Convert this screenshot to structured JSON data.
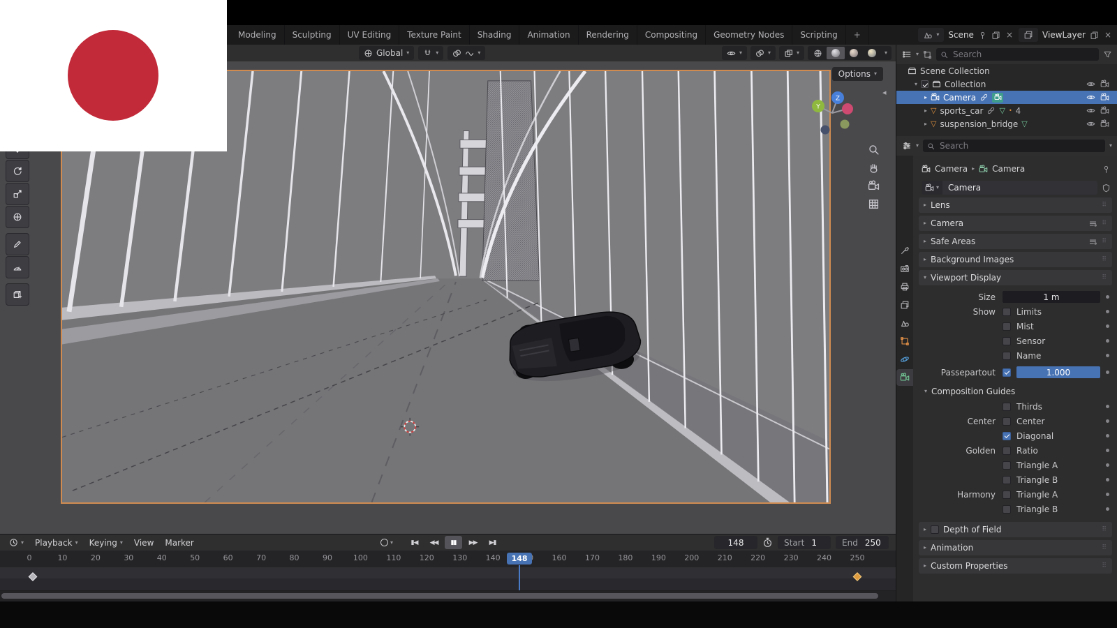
{
  "topbar": {
    "tabs": [
      "Modeling",
      "Sculpting",
      "UV Editing",
      "Texture Paint",
      "Shading",
      "Animation",
      "Rendering",
      "Compositing",
      "Geometry Nodes",
      "Scripting"
    ],
    "add_tab_label": "+",
    "scene_selector_label": "Scene",
    "view_layer_selector_label": "ViewLayer"
  },
  "viewport": {
    "header": {
      "orientation_label": "Global"
    },
    "options_label": "Options",
    "axis_labels": {
      "y": "Y",
      "z": "Z"
    }
  },
  "outliner": {
    "search_placeholder": "Search",
    "scene_collection_label": "Scene Collection",
    "collection_label": "Collection",
    "collection_checked": true,
    "camera_label": "Camera",
    "sports_car_label": "sports_car",
    "sports_car_count": "4",
    "suspension_bridge_label": "suspension_bridge"
  },
  "properties": {
    "search_placeholder": "Search",
    "breadcrumb_object": "Camera",
    "breadcrumb_data": "Camera",
    "name_value": "Camera",
    "panel_lens": "Lens",
    "panel_camera": "Camera",
    "panel_safe_areas": "Safe Areas",
    "panel_background_images": "Background Images",
    "panel_viewport_display": "Viewport Display",
    "panel_composition_guides": "Composition Guides",
    "panel_depth_of_field": "Depth of Field",
    "panel_animation": "Animation",
    "panel_custom_properties": "Custom Properties",
    "depth_of_field_checked": false,
    "viewport_display": {
      "size_label": "Size",
      "size_value": "1 m",
      "show_label": "Show",
      "limits_label": "Limits",
      "limits_checked": false,
      "mist_label": "Mist",
      "mist_checked": false,
      "sensor_label": "Sensor",
      "sensor_checked": false,
      "name_label": "Name",
      "name_checked": false,
      "passepartout_label": "Passepartout",
      "passepartout_checked": true,
      "passepartout_value": "1.000"
    },
    "guide_rows": [
      {
        "group": "",
        "label": "Thirds",
        "checked": false
      },
      {
        "group": "Center",
        "label": "Center",
        "checked": false
      },
      {
        "group": "",
        "label": "Diagonal",
        "checked": true
      },
      {
        "group": "Golden",
        "label": "Ratio",
        "checked": false
      },
      {
        "group": "",
        "label": "Triangle A",
        "checked": false
      },
      {
        "group": "",
        "label": "Triangle B",
        "checked": false
      },
      {
        "group": "Harmony",
        "label": "Triangle A",
        "checked": false
      },
      {
        "group": "",
        "label": "Triangle B",
        "checked": false
      }
    ]
  },
  "timeline": {
    "menus": [
      "Playback",
      "Keying",
      "View",
      "Marker"
    ],
    "transport": {
      "jump_start": "▮◀",
      "prev_key": "◀◀",
      "pause": "▮▮",
      "next_key": "▶▶",
      "jump_end": "▶▮"
    },
    "current_frame": 148,
    "current_frame_display": "148",
    "start_label": "Start",
    "start_value": "1",
    "end_label": "End",
    "end_value": "250",
    "tick_first": 0,
    "tick_step": 10,
    "tick_last": 250,
    "keyframes": [
      {
        "frame": 1,
        "selected": false
      },
      {
        "frame": 250,
        "selected": true
      }
    ]
  },
  "glyphs": {
    "chevron_down": "▾",
    "chevron_right": "▸",
    "chevron_left": "◂",
    "mesh": "▽",
    "close": "×",
    "dot": "•",
    "grip": "⠿"
  },
  "colors": {
    "selection_blue": "#4772b3",
    "camera_frame_orange": "#d08c50",
    "flag_red": "#c22a39"
  }
}
